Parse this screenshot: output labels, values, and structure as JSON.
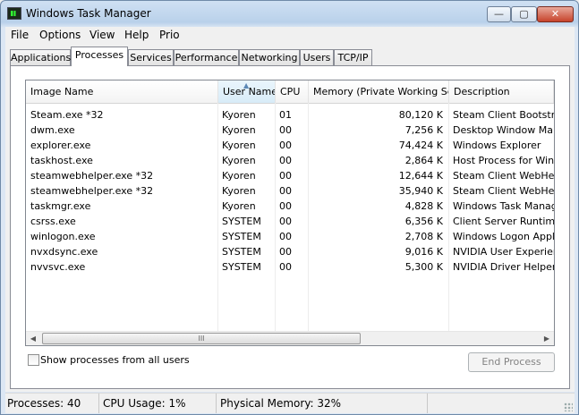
{
  "window": {
    "title": "Windows Task Manager",
    "icon": "task-manager-icon"
  },
  "title_buttons": {
    "minimize": "—",
    "maximize": "▢",
    "close": "✕"
  },
  "menu": [
    "File",
    "Options",
    "View",
    "Help",
    "Prio"
  ],
  "tabs": [
    {
      "label": "Applications",
      "active": false
    },
    {
      "label": "Processes",
      "active": true
    },
    {
      "label": "Services",
      "active": false
    },
    {
      "label": "Performance",
      "active": false
    },
    {
      "label": "Networking",
      "active": false
    },
    {
      "label": "Users",
      "active": false
    },
    {
      "label": "TCP/IP",
      "active": false
    }
  ],
  "columns": [
    "Image Name",
    "User Name",
    "CPU",
    "Memory (Private Working Set)",
    "Description"
  ],
  "sorted_column": "User Name",
  "processes": [
    {
      "image": "Steam.exe *32",
      "user": "Kyoren",
      "cpu": "01",
      "memory": "80,120 K",
      "description": "Steam Client Bootstrap"
    },
    {
      "image": "dwm.exe",
      "user": "Kyoren",
      "cpu": "00",
      "memory": "7,256 K",
      "description": "Desktop Window Manag"
    },
    {
      "image": "explorer.exe",
      "user": "Kyoren",
      "cpu": "00",
      "memory": "74,424 K",
      "description": "Windows Explorer"
    },
    {
      "image": "taskhost.exe",
      "user": "Kyoren",
      "cpu": "00",
      "memory": "2,864 K",
      "description": "Host Process for Windo"
    },
    {
      "image": "steamwebhelper.exe *32",
      "user": "Kyoren",
      "cpu": "00",
      "memory": "12,644 K",
      "description": "Steam Client WebHelpe"
    },
    {
      "image": "steamwebhelper.exe *32",
      "user": "Kyoren",
      "cpu": "00",
      "memory": "35,940 K",
      "description": "Steam Client WebHelpe"
    },
    {
      "image": "taskmgr.exe",
      "user": "Kyoren",
      "cpu": "00",
      "memory": "4,828 K",
      "description": "Windows Task Manager"
    },
    {
      "image": "csrss.exe",
      "user": "SYSTEM",
      "cpu": "00",
      "memory": "6,356 K",
      "description": "Client Server Runtime P"
    },
    {
      "image": "winlogon.exe",
      "user": "SYSTEM",
      "cpu": "00",
      "memory": "2,708 K",
      "description": "Windows Logon Applica"
    },
    {
      "image": "nvxdsync.exe",
      "user": "SYSTEM",
      "cpu": "00",
      "memory": "9,016 K",
      "description": "NVIDIA User Experienc"
    },
    {
      "image": "nvvsvc.exe",
      "user": "SYSTEM",
      "cpu": "00",
      "memory": "5,300 K",
      "description": "NVIDIA Driver Helper S"
    }
  ],
  "scrollbar": {
    "left": "◀",
    "right": "▶",
    "grip": "III"
  },
  "show_all_users": {
    "label": "Show processes from all users",
    "checked": false
  },
  "end_process": {
    "label": "End Process",
    "enabled": false
  },
  "status": {
    "processes": "Processes: 40",
    "cpu": "CPU Usage: 1%",
    "memory": "Physical Memory: 32%"
  }
}
